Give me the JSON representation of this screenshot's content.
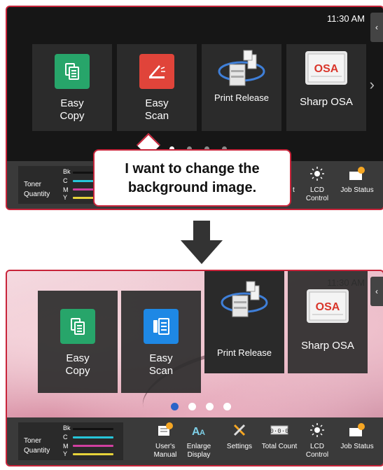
{
  "clock": "11:30 AM",
  "tiles": [
    {
      "label": "Easy Copy",
      "line1": "Easy",
      "line2": "Copy"
    },
    {
      "label": "Easy Scan",
      "line1": "Easy",
      "line2": "Scan"
    },
    {
      "label": "Print Release"
    },
    {
      "label": "Sharp OSA"
    }
  ],
  "toner": {
    "title_line1": "Toner",
    "title_line2": "Quantity",
    "channels": [
      {
        "code": "Bk",
        "color": "#111111"
      },
      {
        "code": "C",
        "color": "#26c6da"
      },
      {
        "code": "M",
        "color": "#d040a0"
      },
      {
        "code": "Y",
        "color": "#e6d23a"
      }
    ]
  },
  "bottom_bar": {
    "users_manual_1": "User's",
    "users_manual_2": "Manual",
    "enlarge_1": "Enlarge",
    "enlarge_2": "Display",
    "settings": "Settings",
    "total_count": "Total Count",
    "lcd_1": "LCD",
    "lcd_2": "Control",
    "job_status": "Job Status"
  },
  "top_partial": {
    "t": "t",
    "lcd_1": "LCD",
    "lcd_2": "Control",
    "job_status": "Job Status"
  },
  "callout": {
    "line1": "I want to change the",
    "line2": "background image."
  },
  "colors": {
    "highlight_border": "#c8243a",
    "copy_green": "#27a56a",
    "scan_red": "#e0443a",
    "scan_blue": "#1e88e5",
    "page_dot_active": "#2a64c8"
  }
}
